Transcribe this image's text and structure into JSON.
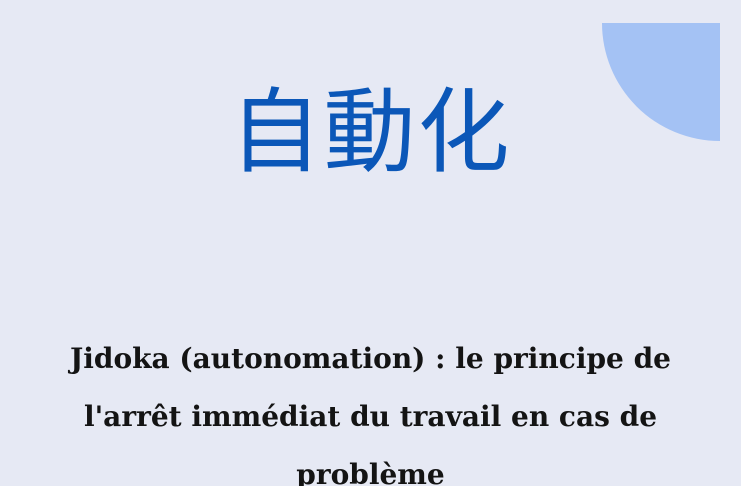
{
  "title": "自動化",
  "subtitle": "Jidoka (autonomation) : le principe de l'arrêt immédiat du travail en cas de problème",
  "colors": {
    "background": "#e6e9f4",
    "accent_shape": "#a4c2f4",
    "title": "#0b57b8",
    "text": "#141414"
  }
}
